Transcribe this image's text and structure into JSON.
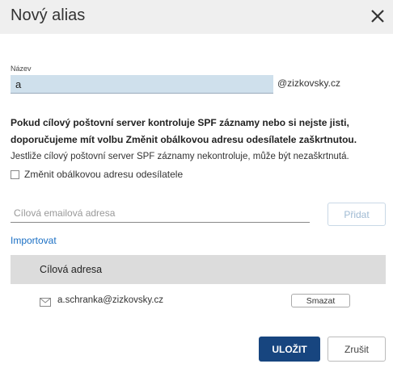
{
  "dialog": {
    "title": "Nový alias",
    "close_icon": "close-icon"
  },
  "name_field": {
    "label": "Název",
    "value": "a",
    "domain_suffix": "@zizkovsky.cz"
  },
  "spf_notice": {
    "warning_line1": "Pokud cílový poštovní server kontroluje SPF záznamy nebo si nejste jisti,",
    "warning_line2": "doporučujeme mít volbu Změnit obálkovou adresu odesílatele zaškrtnutou.",
    "info": "Jestliže cílový poštovní server SPF záznamy nekontroluje, může být nezaškrtnutá."
  },
  "envelope_checkbox": {
    "label": "Změnit obálkovou adresu odesílatele",
    "checked": false
  },
  "target": {
    "placeholder": "Cílová emailová adresa",
    "add_label": "Přidat",
    "import_label": "Importovat"
  },
  "table": {
    "header": "Cílová adresa",
    "rows": [
      {
        "email": "a.schranka@zizkovsky.cz",
        "delete_label": "Smazat",
        "icon": "mail-icon"
      }
    ]
  },
  "footer": {
    "save_label": "ULOŽIT",
    "cancel_label": "Zrušit"
  },
  "colors": {
    "header_bg": "#efefef",
    "input_bg": "#cfe0ec",
    "table_head_bg": "#dcdcdc",
    "primary": "#17457f",
    "link": "#1a6fc4"
  }
}
